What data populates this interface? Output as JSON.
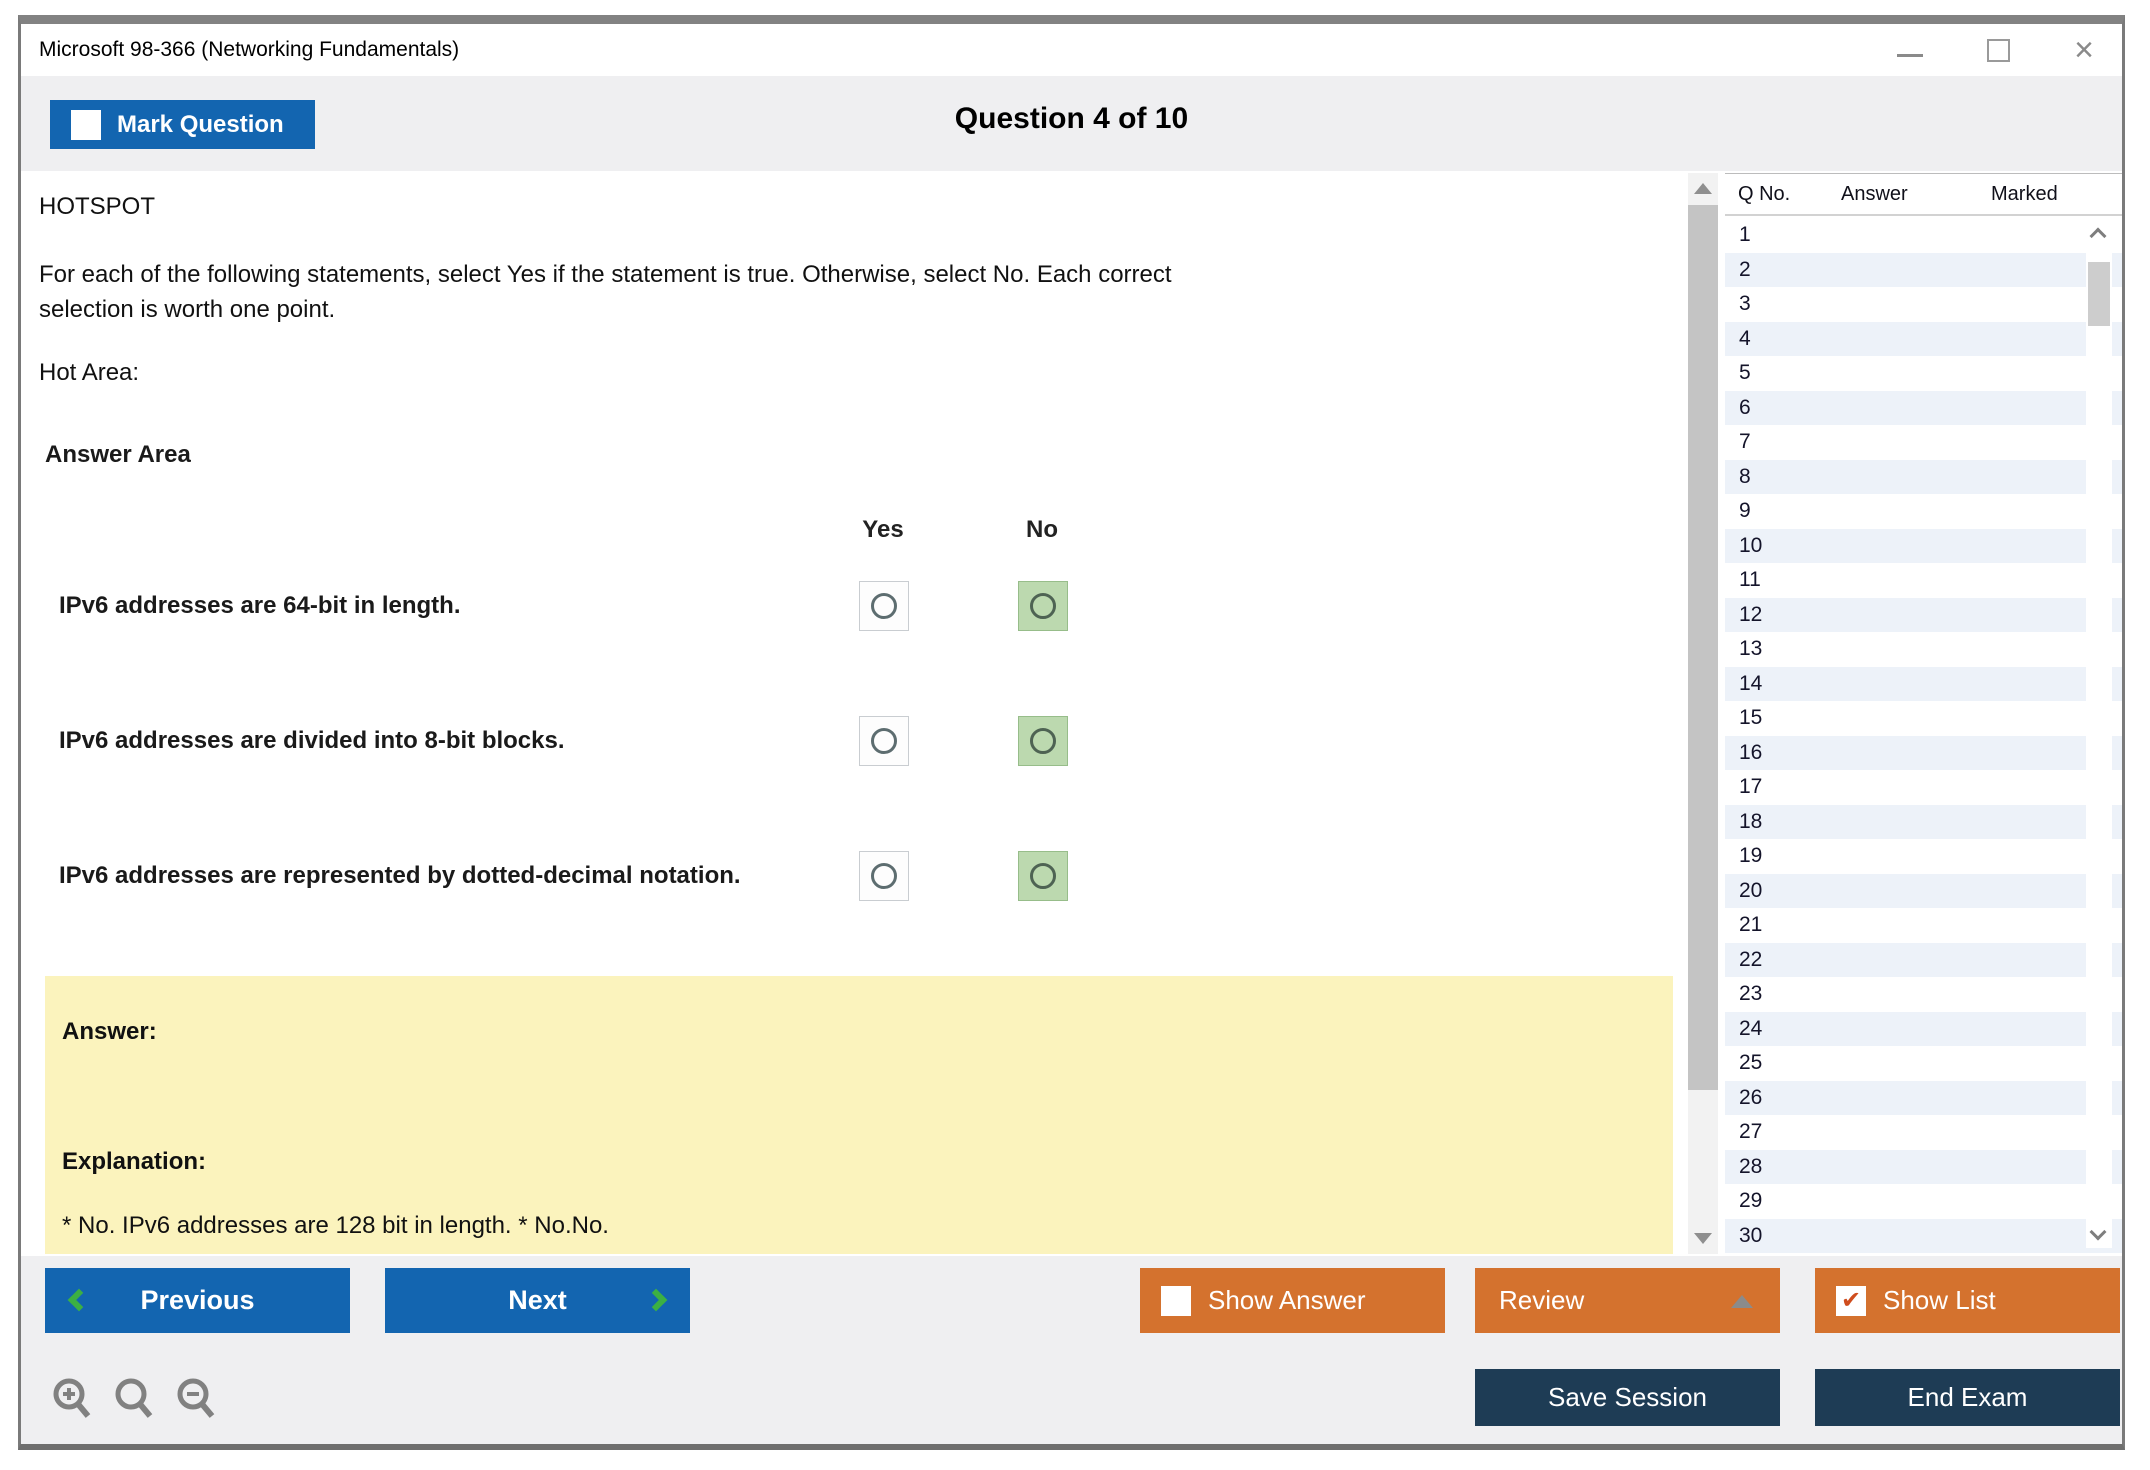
{
  "window": {
    "title": "Microsoft 98-366 (Networking Fundamentals)",
    "controls": {
      "minimize": "minimize",
      "maximize": "maximize",
      "close": "×"
    }
  },
  "header": {
    "mark_question_label": "Mark Question",
    "question_counter": "Question 4 of 10"
  },
  "question": {
    "type_label": "HOTSPOT",
    "instructions": "For each of the following statements, select Yes if the statement is true. Otherwise, select No. Each correct selection is worth one point.",
    "hot_area_label": "Hot Area:",
    "answer_area_label": "Answer Area",
    "columns": [
      "Yes",
      "No"
    ],
    "statements": [
      {
        "text": "IPv6 addresses are 64-bit in length.",
        "highlighted_column": "No",
        "yes_selected": false,
        "no_selected": false
      },
      {
        "text": "IPv6 addresses are divided into 8-bit blocks.",
        "highlighted_column": "No",
        "yes_selected": false,
        "no_selected": false
      },
      {
        "text": "IPv6 addresses are represented by dotted-decimal notation.",
        "highlighted_column": "No",
        "yes_selected": false,
        "no_selected": false
      }
    ]
  },
  "answer_panel": {
    "answer_label": "Answer:",
    "explanation_label": "Explanation:",
    "explanation_text": "* No. IPv6 addresses are 128 bit in length. * No.No."
  },
  "question_list": {
    "headers": {
      "q_no": "Q No.",
      "answer": "Answer",
      "marked": "Marked"
    },
    "rows": [
      "1",
      "2",
      "3",
      "4",
      "5",
      "6",
      "7",
      "8",
      "9",
      "10",
      "11",
      "12",
      "13",
      "14",
      "15",
      "16",
      "17",
      "18",
      "19",
      "20",
      "21",
      "22",
      "23",
      "24",
      "25",
      "26",
      "27",
      "28",
      "29",
      "30"
    ]
  },
  "footer": {
    "previous_label": "Previous",
    "next_label": "Next",
    "show_answer_label": "Show Answer",
    "review_label": "Review",
    "show_list_label": "Show List",
    "show_list_checked": true,
    "show_answer_checked": false,
    "save_session_label": "Save Session",
    "end_exam_label": "End Exam"
  },
  "icons": {
    "show_list_check": "✔",
    "close": "×"
  },
  "colors": {
    "accent_blue": "#1365b0",
    "accent_orange": "#d4722e",
    "navy": "#1e3c55",
    "chevron_green": "#3cb043",
    "answer_panel_yellow": "#fbf3bd",
    "highlight_green": "#bcd9af",
    "alt_row_blue": "#edf2f9",
    "window_border_gray": "#7a7a7a"
  }
}
